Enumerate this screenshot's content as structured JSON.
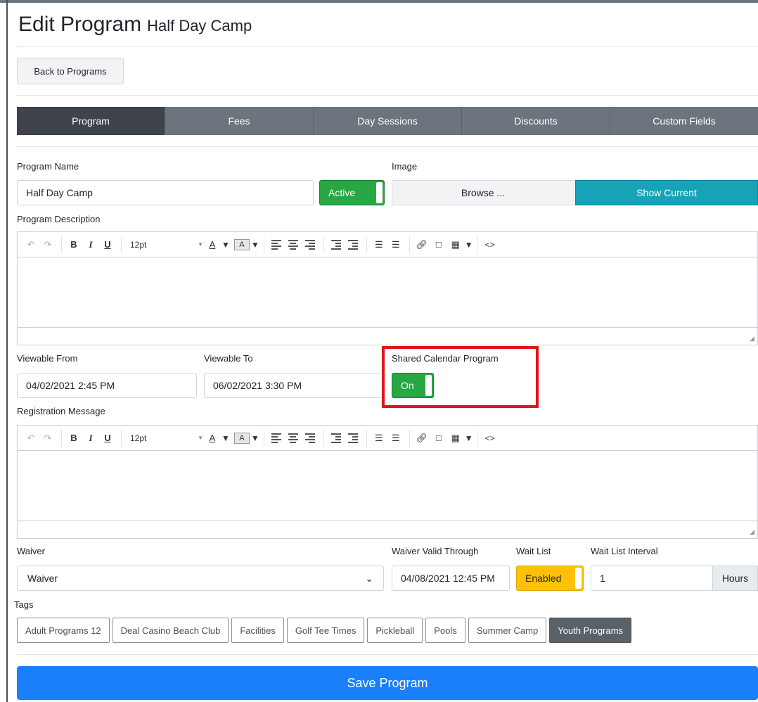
{
  "page": {
    "title": "Edit Program",
    "subtitle": "Half Day Camp",
    "back_button": "Back to Programs"
  },
  "tabs": [
    {
      "label": "Program",
      "active": true
    },
    {
      "label": "Fees",
      "active": false
    },
    {
      "label": "Day Sessions",
      "active": false
    },
    {
      "label": "Discounts",
      "active": false
    },
    {
      "label": "Custom Fields",
      "active": false
    }
  ],
  "program_name": {
    "label": "Program Name",
    "value": "Half Day Camp",
    "status_toggle": "Active"
  },
  "image": {
    "label": "Image",
    "browse_label": "Browse ...",
    "show_current_label": "Show Current"
  },
  "description": {
    "label": "Program Description"
  },
  "editor_toolbar": {
    "undo_icon": "undo-icon",
    "redo_icon": "redo-icon",
    "bold": "B",
    "italic": "I",
    "underline": "U",
    "font_size": "12pt",
    "font_color": "A",
    "bg_color": "A"
  },
  "viewable_from": {
    "label": "Viewable From",
    "value": "04/02/2021 2:45 PM"
  },
  "viewable_to": {
    "label": "Viewable To",
    "value": "06/02/2021 3:30 PM"
  },
  "shared_calendar": {
    "label": "Shared Calendar Program",
    "toggle": "On"
  },
  "registration_message": {
    "label": "Registration Message"
  },
  "waiver": {
    "label": "Waiver",
    "value": "Waiver"
  },
  "waiver_valid_through": {
    "label": "Waiver Valid Through",
    "value": "04/08/2021 12:45 PM"
  },
  "wait_list": {
    "label": "Wait List",
    "toggle": "Enabled"
  },
  "wait_list_interval": {
    "label": "Wait List Interval",
    "value": "1",
    "unit": "Hours"
  },
  "tags": {
    "label": "Tags",
    "items": [
      {
        "label": "Adult Programs 12",
        "selected": false
      },
      {
        "label": "Deal Casino Beach Club",
        "selected": false
      },
      {
        "label": "Facilities",
        "selected": false
      },
      {
        "label": "Golf Tee Times",
        "selected": false
      },
      {
        "label": "Pickleball",
        "selected": false
      },
      {
        "label": "Pools",
        "selected": false
      },
      {
        "label": "Summer Camp",
        "selected": false
      },
      {
        "label": "Youth Programs",
        "selected": true
      }
    ]
  },
  "save_button": "Save Program",
  "colors": {
    "tab_bar": "#6c757d",
    "tab_active": "#3e444a",
    "toggle_green": "#28a745",
    "toggle_yellow": "#ffc107",
    "show_current": "#17a2b8",
    "save": "#1a7ffb",
    "highlight": "#e3131b"
  }
}
